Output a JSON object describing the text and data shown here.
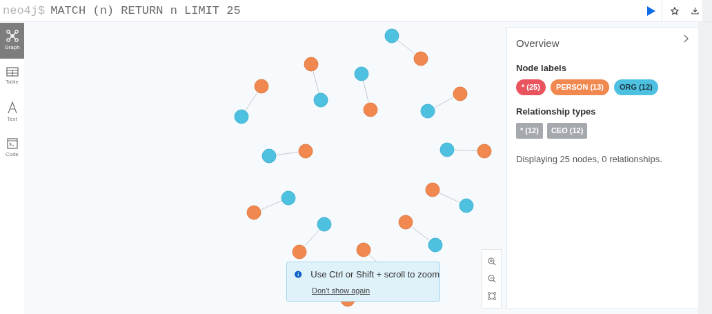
{
  "query": {
    "prompt": "neo4j$",
    "text": "MATCH (n) RETURN n LIMIT 25"
  },
  "sidebar": {
    "items": [
      {
        "label": "Graph",
        "selected": true
      },
      {
        "label": "Table",
        "selected": false
      },
      {
        "label": "Text",
        "selected": false
      },
      {
        "label": "Code",
        "selected": false
      }
    ]
  },
  "graph": {
    "nodes": [
      {
        "kind": "org"
      },
      {
        "kind": "person"
      },
      {
        "kind": "person"
      },
      {
        "kind": "org"
      },
      {
        "kind": "person"
      },
      {
        "kind": "org"
      },
      {
        "kind": "org"
      },
      {
        "kind": "person"
      },
      {
        "kind": "person"
      },
      {
        "kind": "org"
      },
      {
        "kind": "org"
      },
      {
        "kind": "person"
      },
      {
        "kind": "org"
      },
      {
        "kind": "person"
      },
      {
        "kind": "person"
      },
      {
        "kind": "org"
      },
      {
        "kind": "org"
      },
      {
        "kind": "person"
      },
      {
        "kind": "org"
      },
      {
        "kind": "person"
      },
      {
        "kind": "person"
      },
      {
        "kind": "org"
      },
      {
        "kind": "person"
      },
      {
        "kind": "person"
      }
    ]
  },
  "hint": {
    "text": "Use Ctrl or Shift + scroll to zoom",
    "link": "Don't show again"
  },
  "overview": {
    "title": "Overview",
    "node_labels_heading": "Node labels",
    "node_labels": [
      {
        "label": "* (25)",
        "color": "#e9545e"
      },
      {
        "label": "PERSON (13)",
        "color": "#f0884f"
      },
      {
        "label": "ORG (12)",
        "color": "#4fc1e0"
      }
    ],
    "relationship_types_heading": "Relationship types",
    "relationship_types": [
      {
        "label": "* (12)"
      },
      {
        "label": "CEO (12)"
      }
    ],
    "summary": "Displaying 25 nodes, 0 relationships."
  }
}
